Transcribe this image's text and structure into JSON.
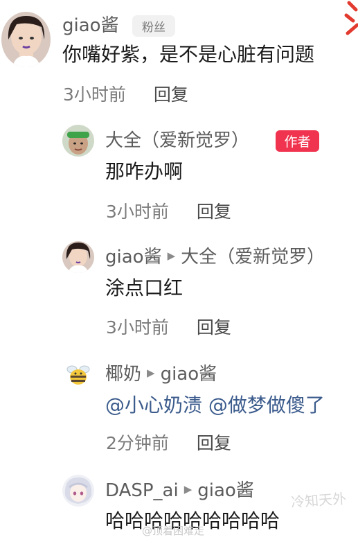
{
  "comments": [
    {
      "user": "giao酱",
      "badge": "粉丝",
      "text": "你嘴好紫，是不是心脏有问题",
      "time": "3小时前",
      "reply_label": "回复",
      "avatar_icon": "cartoon-woman-avatar"
    },
    {
      "user": "大全（爱新觉罗）",
      "badge": "作者",
      "text": "那咋办啊",
      "time": "3小时前",
      "reply_label": "回复",
      "avatar_icon": "man-green-headband-avatar"
    },
    {
      "user": "giao酱",
      "reply_to": "大全（爱新觉罗）",
      "text": "涂点口红",
      "time": "3小时前",
      "reply_label": "回复",
      "avatar_icon": "cartoon-woman-avatar"
    },
    {
      "user": "椰奶",
      "reply_to": "giao酱",
      "text": "@小心奶渍 @做梦做傻了",
      "time": "2分钟前",
      "reply_label": "回复",
      "avatar_icon": "bee-avatar"
    },
    {
      "user": "DASP_ai",
      "reply_to": "giao酱",
      "text": "哈哈哈哈哈哈哈哈哈",
      "avatar_icon": "anime-girl-avatar"
    }
  ],
  "watermark": "@顶着困难走",
  "watermark2": "冷知天外",
  "colors": {
    "author_badge": "#f0334e",
    "mention": "#3b5b8c",
    "meta": "#7a7a7a"
  }
}
